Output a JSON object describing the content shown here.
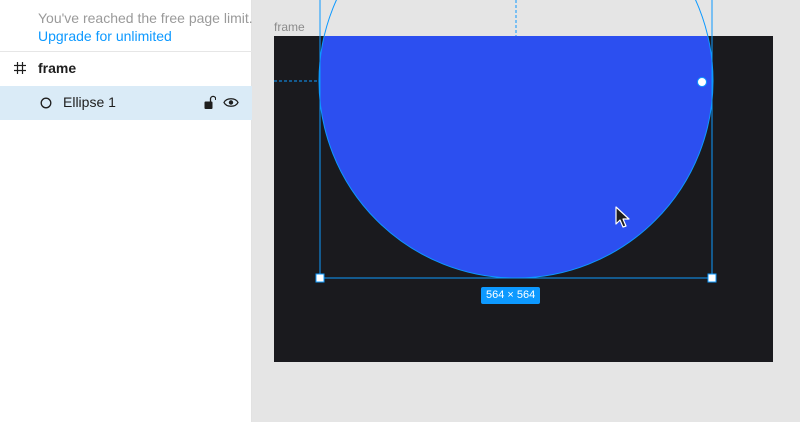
{
  "notice": {
    "limit_text": "You've reached the free page limit.",
    "upgrade_label": "Upgrade for unlimited"
  },
  "layers": [
    {
      "name": "frame",
      "icon": "hash-frame-icon",
      "selected": false
    },
    {
      "name": "Ellipse 1",
      "icon": "ellipse-icon",
      "selected": true,
      "locked": false,
      "visible": true
    }
  ],
  "canvas": {
    "frame_label": "frame",
    "size_badge": "564 × 564"
  },
  "colors": {
    "accent": "#0d99ff",
    "ellipse_fill": "#2c4ff0",
    "frame_fill": "#1a1a1e",
    "selected_row": "#daebf7",
    "canvas_bg": "#e5e5e5"
  }
}
